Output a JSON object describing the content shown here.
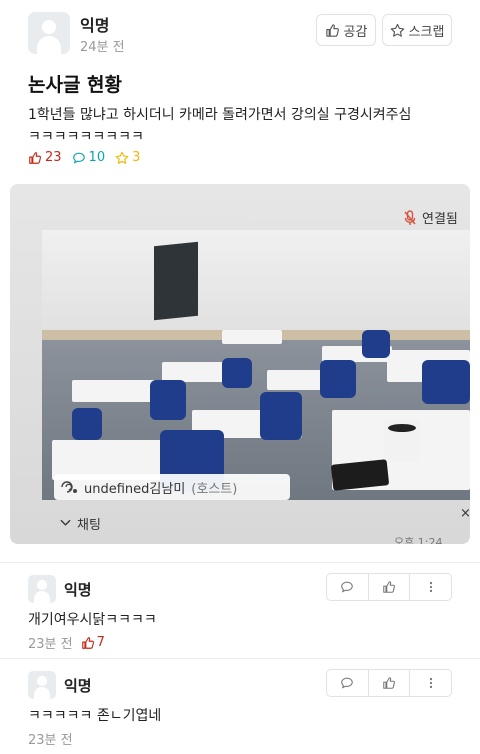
{
  "post": {
    "author": "익명",
    "time": "24분 전",
    "like_button_label": "공감",
    "scrap_button_label": "스크랩",
    "title": "논사글 현황",
    "body_line1": "1학년들 많냐고 하시더니 카메라 돌려가면서 강의실 구경시켜주심",
    "body_line2": "ㅋㅋㅋㅋㅋㅋㅋㅋㅋ",
    "stats": {
      "likes": "23",
      "comments": "10",
      "scraps": "3"
    },
    "colors": {
      "like": "#c62917",
      "comment": "#0ca5af",
      "scrap": "#f2b705"
    }
  },
  "photo": {
    "connected_label": "연결됨",
    "host_name": "undefined김남미",
    "host_tag": "(호스트)",
    "chat_label": "채팅",
    "close_icon": "×",
    "time_label": "오후 1:24"
  },
  "comments": [
    {
      "author": "익명",
      "text": "개기여우시닭ㅋㅋㅋㅋ",
      "time": "23분 전",
      "likes": "7"
    },
    {
      "author": "익명",
      "text": "ㅋㅋㅋㅋㅋ 존ㄴ기엽네",
      "time": "23분 전",
      "likes": ""
    }
  ]
}
